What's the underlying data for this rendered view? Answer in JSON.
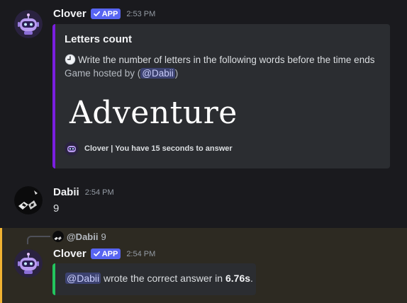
{
  "messages": [
    {
      "author": "Clover",
      "badge": "APP",
      "time": "2:53 PM",
      "embed": {
        "title": "Letters count",
        "description": "Write the number of letters in the following words before the time ends",
        "host_prefix": "Game hosted by (",
        "host_mention": "@Dabii",
        "host_suffix": ")",
        "word": "Adventure",
        "footer": "Clover | You have 15 seconds to answer",
        "accent_color": "#7a1fe0"
      }
    },
    {
      "author": "Dabii",
      "time": "2:54 PM",
      "content": "9"
    },
    {
      "reply": {
        "author": "@Dabii",
        "text": "9"
      },
      "author": "Clover",
      "badge": "APP",
      "time": "2:54 PM",
      "embed": {
        "mention": "@Dabii",
        "text_before": " wrote the correct answer in ",
        "time_value": "6.76s",
        "text_after": ".",
        "accent_color": "#23c55e"
      }
    }
  ],
  "icons": {
    "clock": "clock-icon",
    "check": "checkmark-icon",
    "bot_avatar": "robot-avatar",
    "user_avatar": "user-avatar"
  },
  "colors": {
    "background": "#1a1a1e",
    "highlight": "#2d2a22",
    "highlight_bar": "#f0b232",
    "badge": "#5865f2",
    "mention_bg": "#3c4270"
  }
}
